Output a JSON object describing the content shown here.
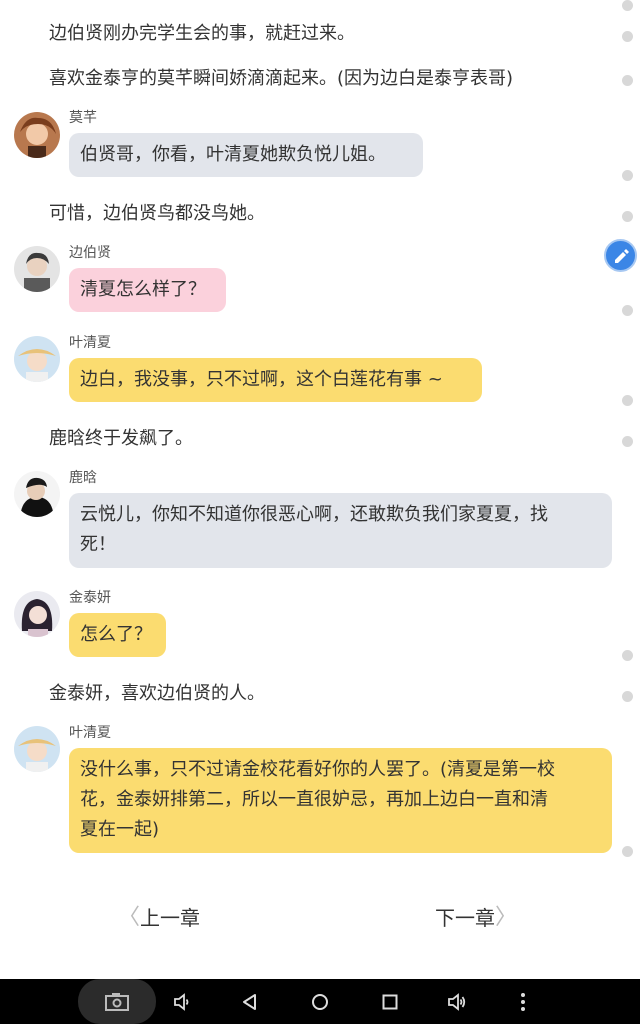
{
  "story": {
    "narration_1": "边伯贤刚办完学生会的事，就赶过来。",
    "narration_2": "喜欢金泰亨的莫芊瞬间娇滴滴起来。(因为边白是泰亨表哥)",
    "narration_3": "可惜，边伯贤鸟都没鸟她。",
    "narration_4": "鹿晗终于发飙了。",
    "narration_5": "金泰妍，喜欢边伯贤的人。"
  },
  "messages": [
    {
      "speaker": "莫芊",
      "text": "伯贤哥，你看，叶清夏她欺负悦儿姐。",
      "color": "#e2e5eb"
    },
    {
      "speaker": "边伯贤",
      "text": "清夏怎么样了？",
      "color": "#fbd1dc"
    },
    {
      "speaker": "叶清夏",
      "text": "边白，我没事，只不过啊，这个白莲花有事 ~",
      "color": "#fbdc70"
    },
    {
      "speaker": "鹿晗",
      "text_line1": "云悦儿，你知不知道你很恶心啊，还敢欺负我们家夏夏，找",
      "text_line2": "死！",
      "color": "#e2e5eb"
    },
    {
      "speaker": "金泰妍",
      "text": "怎么了？",
      "color": "#fbdc70"
    },
    {
      "speaker": "叶清夏",
      "text_line1": "没什么事，只不过请金校花看好你的人罢了。(清夏是第一校",
      "text_line2": "花，金泰妍排第二，所以一直很妒忌，再加上边白一直和清",
      "text_line3": "夏在一起)",
      "color": "#fbdc70"
    }
  ],
  "chapter_nav": {
    "prev_label": "上一章",
    "next_label": "下一章"
  },
  "floating_button": {
    "icon": "pencil-icon",
    "color": "#3b86e6"
  },
  "system_nav": {
    "icons": [
      "screenshot-icon",
      "volume-down-icon",
      "back-icon",
      "home-icon",
      "recents-icon",
      "volume-up-icon",
      "more-icon"
    ]
  }
}
